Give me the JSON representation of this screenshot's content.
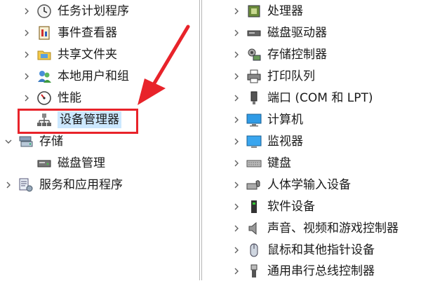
{
  "left_tree": {
    "items": [
      {
        "label": "任务计划程序",
        "icon": "clock-icon",
        "chevron": "right"
      },
      {
        "label": "事件查看器",
        "icon": "event-viewer-icon",
        "chevron": "right"
      },
      {
        "label": "共享文件夹",
        "icon": "shared-folder-icon",
        "chevron": "right"
      },
      {
        "label": "本地用户和组",
        "icon": "users-icon",
        "chevron": "right"
      },
      {
        "label": "性能",
        "icon": "performance-icon",
        "chevron": "right"
      },
      {
        "label": "设备管理器",
        "icon": "device-manager-icon",
        "chevron": "none",
        "selected": true
      },
      {
        "label": "存储",
        "icon": "storage-icon",
        "chevron": "down"
      },
      {
        "label": "磁盘管理",
        "icon": "disk-management-icon",
        "chevron": "none"
      },
      {
        "label": "服务和应用程序",
        "icon": "services-icon",
        "chevron": "right"
      }
    ]
  },
  "device_list": {
    "items": [
      {
        "label": "处理器",
        "icon": "processor-icon"
      },
      {
        "label": "磁盘驱动器",
        "icon": "disk-drive-icon"
      },
      {
        "label": "存储控制器",
        "icon": "storage-controller-icon"
      },
      {
        "label": "打印队列",
        "icon": "printer-icon"
      },
      {
        "label": "端口 (COM 和 LPT)",
        "icon": "port-icon"
      },
      {
        "label": "计算机",
        "icon": "computer-icon"
      },
      {
        "label": "监视器",
        "icon": "monitor-icon"
      },
      {
        "label": "键盘",
        "icon": "keyboard-icon"
      },
      {
        "label": "人体学输入设备",
        "icon": "hid-icon"
      },
      {
        "label": "软件设备",
        "icon": "software-device-icon"
      },
      {
        "label": "声音、视频和游戏控制器",
        "icon": "speaker-icon"
      },
      {
        "label": "鼠标和其他指针设备",
        "icon": "mouse-icon"
      },
      {
        "label": "通用串行总线控制器",
        "icon": "usb-icon"
      }
    ]
  },
  "colors": {
    "selection": "#cce8ff",
    "annotation_red": "#e8232a"
  }
}
